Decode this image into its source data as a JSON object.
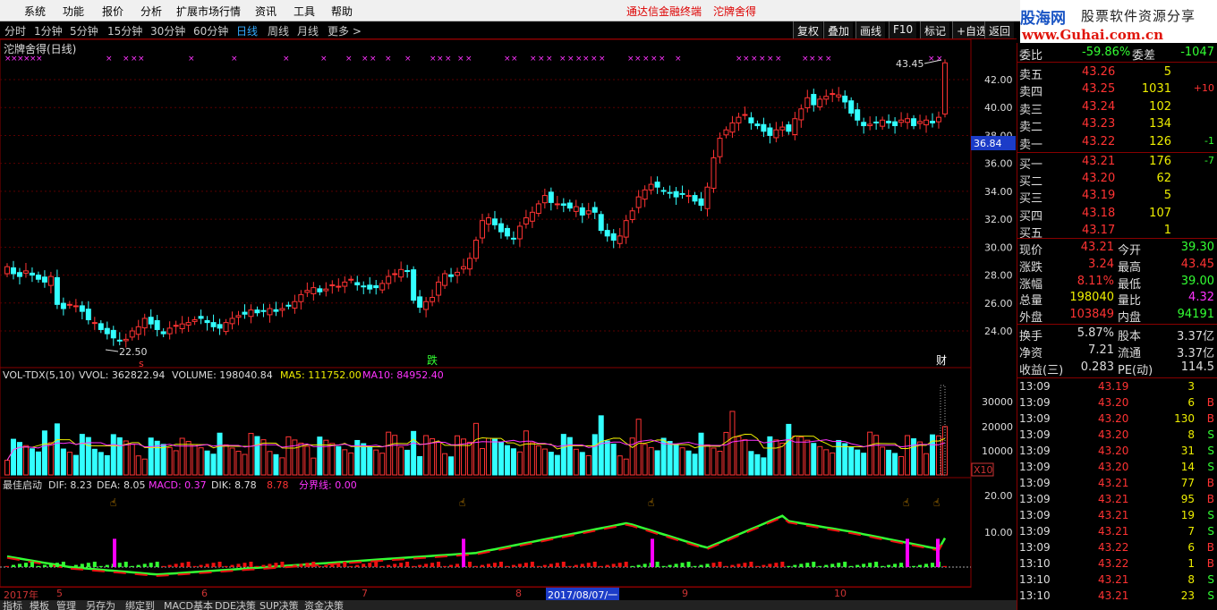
{
  "menu": {
    "items": [
      "系统",
      "功能",
      "报价",
      "分析",
      "扩展市场行情",
      "资讯",
      "工具",
      "帮助"
    ],
    "center_left": "通达信金融终端",
    "center_right": "沱牌舍得"
  },
  "logo": {
    "site": "股海网",
    "slogan": "股票软件资源分享",
    "url": "www.Guhai.com.cn"
  },
  "toolbar": {
    "periods": [
      "分时",
      "1分钟",
      "5分钟",
      "15分钟",
      "30分钟",
      "60分钟",
      "日线",
      "周线",
      "月线",
      "更多 >"
    ],
    "active_period": "日线",
    "buttons": [
      "复权",
      "叠加",
      "画线",
      "F10",
      "标记",
      "+自选",
      "返回"
    ]
  },
  "chart_title": "沱牌舍得(日线)",
  "price_chart": {
    "yticks": [
      "42.00",
      "40.00",
      "38.00",
      "36.00",
      "34.00",
      "32.00",
      "30.00",
      "28.00",
      "26.00",
      "24.00"
    ],
    "current_label": "36.84",
    "high_label": "43.45",
    "low_label": "22.50",
    "marker_die": "跌",
    "marker_cai": "财",
    "marker_s": "s"
  },
  "vol_panel": {
    "title": "VOL-TDX(5,10)",
    "vvol": "VVOL: 362822.94",
    "volume": "VOLUME: 198040.84",
    "ma5": "MA5: 111752.00",
    "ma10": "MA10: 84952.40",
    "yticks": [
      "30000",
      "20000",
      "10000"
    ],
    "unit": "X10"
  },
  "macd_panel": {
    "title": "最佳启动",
    "dif": "DIF: 8.23",
    "dea": "DEA: 8.05",
    "macd": "MACD: 0.37",
    "dik": "DIK: 8.78",
    "dik2": "8.78",
    "line": "分界线: 0.00",
    "yticks": [
      "20.00",
      "10.00"
    ]
  },
  "date_axis": {
    "year": "2017年",
    "months": [
      "5",
      "6",
      "7",
      "8",
      "9",
      "10"
    ],
    "cursor_date": "2017/08/07/一"
  },
  "bottom_tabs": [
    "指标",
    "模板",
    "管理",
    "另存为",
    "绑定到",
    "MACD基本",
    "DDE决策",
    "SUP决策",
    "资金决策"
  ],
  "quote": {
    "weibi_label": "委比",
    "weibi": "-59.86%",
    "weicha_label": "委差",
    "weicha": "-1047",
    "asks": [
      {
        "label": "卖五",
        "price": "43.26",
        "vol": "5",
        "chg": ""
      },
      {
        "label": "卖四",
        "price": "43.25",
        "vol": "1031",
        "chg": "+10"
      },
      {
        "label": "卖三",
        "price": "43.24",
        "vol": "102",
        "chg": ""
      },
      {
        "label": "卖二",
        "price": "43.23",
        "vol": "134",
        "chg": ""
      },
      {
        "label": "卖一",
        "price": "43.22",
        "vol": "126",
        "chg": "-1"
      }
    ],
    "bids": [
      {
        "label": "买一",
        "price": "43.21",
        "vol": "176",
        "chg": "-7"
      },
      {
        "label": "买二",
        "price": "43.20",
        "vol": "62",
        "chg": ""
      },
      {
        "label": "买三",
        "price": "43.19",
        "vol": "5",
        "chg": ""
      },
      {
        "label": "买四",
        "price": "43.18",
        "vol": "107",
        "chg": ""
      },
      {
        "label": "买五",
        "price": "43.17",
        "vol": "1",
        "chg": ""
      }
    ],
    "stats": [
      {
        "l1": "现价",
        "v1": "43.21",
        "l2": "今开",
        "v2": "39.30"
      },
      {
        "l1": "涨跌",
        "v1": "3.24",
        "l2": "最高",
        "v2": "43.45"
      },
      {
        "l1": "涨幅",
        "v1": "8.11%",
        "l2": "最低",
        "v2": "39.00"
      },
      {
        "l1": "总量",
        "v1": "198040",
        "l2": "量比",
        "v2": "4.32"
      },
      {
        "l1": "外盘",
        "v1": "103849",
        "l2": "内盘",
        "v2": "94191"
      }
    ],
    "stats2": [
      {
        "l1": "换手",
        "v1": "5.87%",
        "l2": "股本",
        "v2": "3.37亿"
      },
      {
        "l1": "净资",
        "v1": "7.21",
        "l2": "流通",
        "v2": "3.37亿"
      },
      {
        "l1": "收益(三)",
        "v1": "0.283",
        "l2": "PE(动)",
        "v2": "114.5"
      }
    ],
    "ticks": [
      {
        "t": "13:09",
        "p": "43.19",
        "v": "3",
        "s": ""
      },
      {
        "t": "13:09",
        "p": "43.20",
        "v": "6",
        "s": "B"
      },
      {
        "t": "13:09",
        "p": "43.20",
        "v": "130",
        "s": "B"
      },
      {
        "t": "13:09",
        "p": "43.20",
        "v": "8",
        "s": "S"
      },
      {
        "t": "13:09",
        "p": "43.20",
        "v": "31",
        "s": "S"
      },
      {
        "t": "13:09",
        "p": "43.20",
        "v": "14",
        "s": "S"
      },
      {
        "t": "13:09",
        "p": "43.21",
        "v": "77",
        "s": "B"
      },
      {
        "t": "13:09",
        "p": "43.21",
        "v": "95",
        "s": "B"
      },
      {
        "t": "13:09",
        "p": "43.21",
        "v": "19",
        "s": "S"
      },
      {
        "t": "13:09",
        "p": "43.21",
        "v": "7",
        "s": "S"
      },
      {
        "t": "13:09",
        "p": "43.22",
        "v": "6",
        "s": "B"
      },
      {
        "t": "13:10",
        "p": "43.22",
        "v": "1",
        "s": "B"
      },
      {
        "t": "13:10",
        "p": "43.21",
        "v": "8",
        "s": "S"
      },
      {
        "t": "13:10",
        "p": "43.21",
        "v": "23",
        "s": "S"
      }
    ]
  }
}
